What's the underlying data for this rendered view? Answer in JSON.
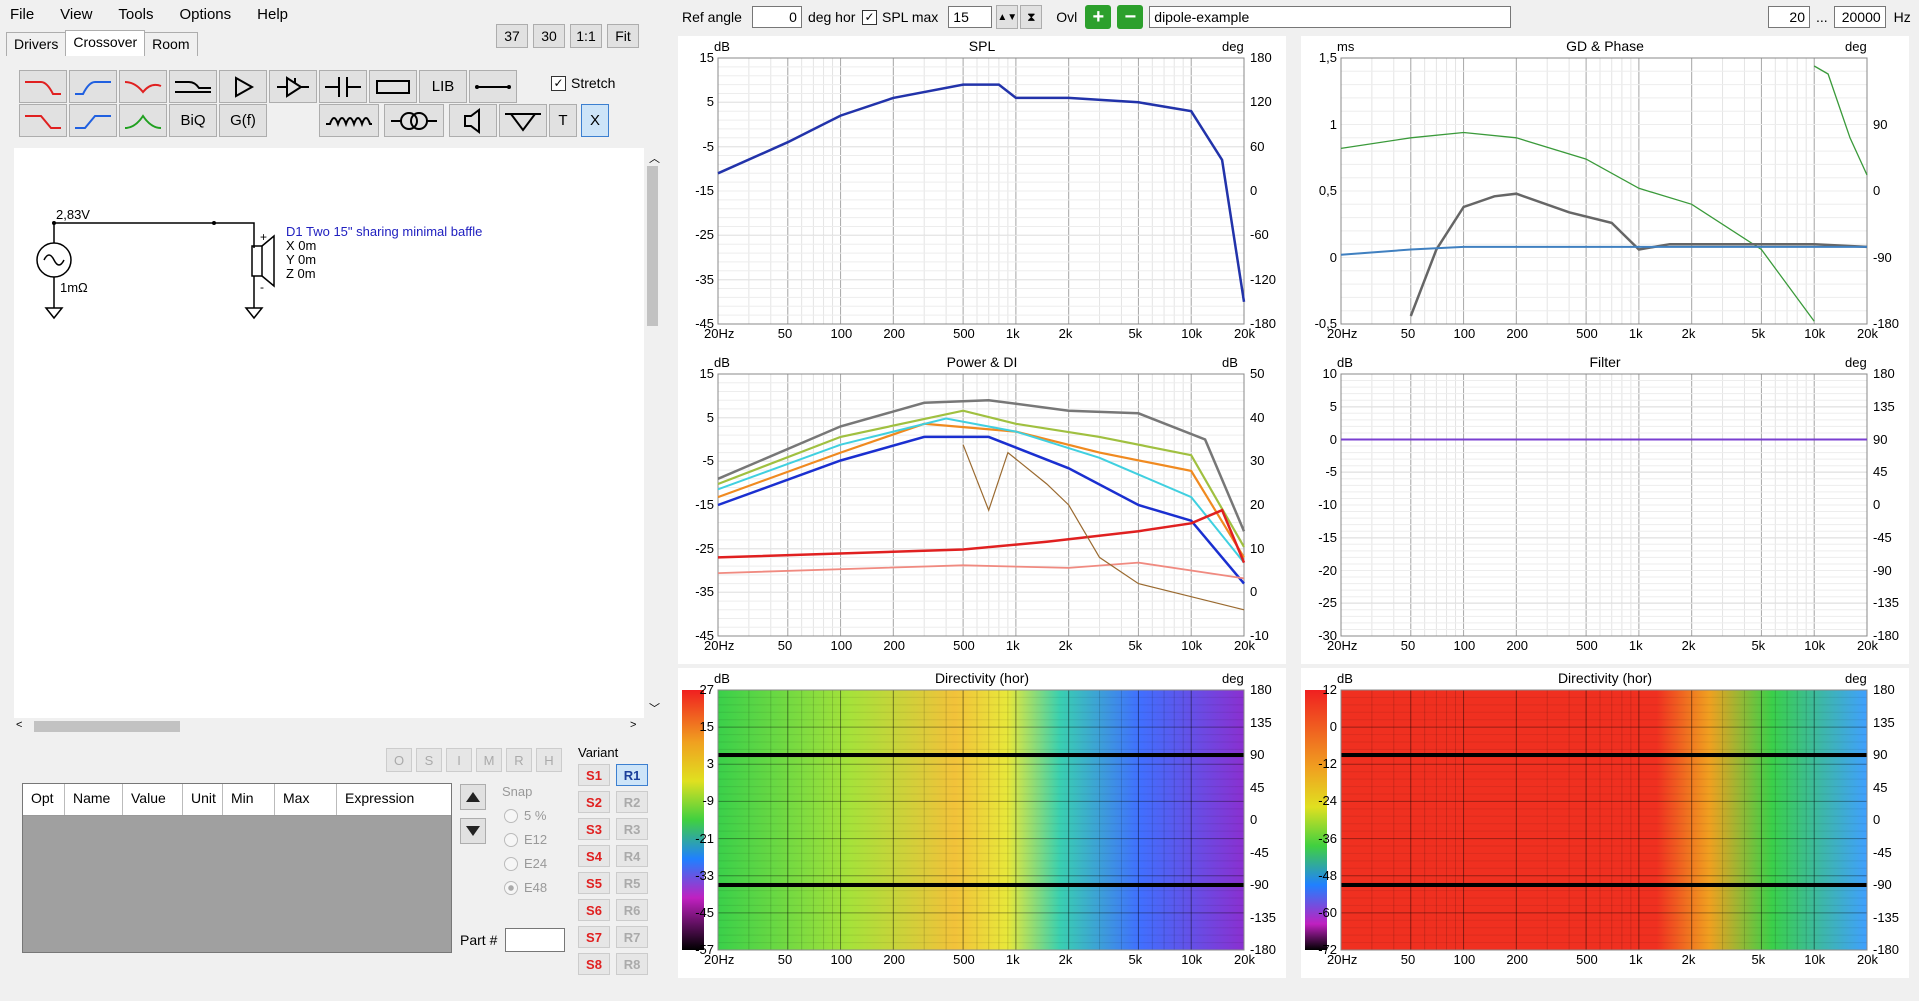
{
  "menu": [
    "File",
    "View",
    "Tools",
    "Options",
    "Help"
  ],
  "tabs": [
    "Drivers",
    "Crossover",
    "Room"
  ],
  "top_buttons": [
    "37",
    "30",
    "1:1",
    "Fit"
  ],
  "component_text": {
    "lib": "LIB",
    "biq": "BiQ",
    "gf": "G(f)",
    "t": "T",
    "x": "X"
  },
  "stretch_label": "Stretch",
  "schematic": {
    "voltage": "2,83V",
    "resistance": "1mΩ",
    "driver_name": "D1 Two 15\" sharing minimal baffle",
    "x": "X 0m",
    "y": "Y 0m",
    "z": "Z 0m"
  },
  "side_buttons": [
    "O",
    "S",
    "I",
    "M",
    "R",
    "H"
  ],
  "table_headers": [
    "Opt",
    "Name",
    "Value",
    "Unit",
    "Min",
    "Max",
    "Expression"
  ],
  "snap": {
    "label": "Snap",
    "options": [
      "5 %",
      "E12",
      "E24",
      "E48"
    ],
    "selected": "E48"
  },
  "part_label": "Part #",
  "variant": {
    "label": "Variant",
    "s": [
      "S1",
      "S2",
      "S3",
      "S4",
      "S5",
      "S6",
      "S7",
      "S8"
    ],
    "r": [
      "R1",
      "R2",
      "R3",
      "R4",
      "R5",
      "R6",
      "R7",
      "R8"
    ],
    "active": "R1"
  },
  "topbar": {
    "ref_angle_label": "Ref angle",
    "ref_angle": "0",
    "deg_hor": "deg hor",
    "spl_max_label": "SPL max",
    "spl_max": "15",
    "ovl": "Ovl",
    "project": "dipole-example",
    "f_min": "20",
    "dots": "...",
    "f_max": "20000",
    "hz": "Hz"
  },
  "freq_ticks": [
    "20Hz",
    "50",
    "100",
    "200",
    "500",
    "1k",
    "2k",
    "5k",
    "10k",
    "20k"
  ],
  "panels": {
    "spl": {
      "title": "SPL",
      "left_unit": "dB",
      "right_unit": "deg",
      "left": [
        "15",
        "5",
        "-5",
        "-15",
        "-25",
        "-35",
        "-45"
      ],
      "right": [
        "180",
        "120",
        "60",
        "0",
        "-60",
        "-120",
        "-180"
      ]
    },
    "gd": {
      "title": "GD & Phase",
      "left_unit": "ms",
      "right_unit": "deg",
      "left": [
        "1,5",
        "1",
        "0,5",
        "0",
        "-0,5"
      ],
      "right": [
        "",
        "90",
        "0",
        "-90",
        "-180"
      ]
    },
    "power": {
      "title": "Power & DI",
      "left_unit": "dB",
      "right_unit": "dB",
      "left": [
        "15",
        "5",
        "-5",
        "-15",
        "-25",
        "-35",
        "-45"
      ],
      "right": [
        "50",
        "40",
        "30",
        "20",
        "10",
        "0",
        "-10"
      ]
    },
    "filter": {
      "title": "Filter",
      "left_unit": "dB",
      "right_unit": "deg",
      "left": [
        "10",
        "5",
        "0",
        "-5",
        "-10",
        "-15",
        "-20",
        "-25",
        "-30"
      ],
      "right": [
        "180",
        "135",
        "90",
        "45",
        "0",
        "-45",
        "-90",
        "-135",
        "-180"
      ]
    },
    "dir1": {
      "title": "Directivity (hor)",
      "left_unit": "dB",
      "right_unit": "deg",
      "left": [
        "27",
        "15",
        "3",
        "-9",
        "-21",
        "-33",
        "-45",
        "-57"
      ],
      "right": [
        "180",
        "135",
        "90",
        "45",
        "0",
        "-45",
        "-90",
        "-135",
        "-180"
      ]
    },
    "dir2": {
      "title": "Directivity (hor)",
      "left_unit": "dB",
      "right_unit": "deg",
      "left": [
        "12",
        "0",
        "-12",
        "-24",
        "-36",
        "-48",
        "-60",
        "-72"
      ],
      "right": [
        "180",
        "135",
        "90",
        "45",
        "0",
        "-45",
        "-90",
        "-135",
        "-180"
      ]
    }
  },
  "colors": {
    "spl_curve": "#2233aa",
    "phase": "#3a9a3a",
    "gd": "#666666",
    "filter": "#7a3fd0",
    "accent": "#0078d7"
  },
  "chart_data": [
    {
      "type": "line",
      "title": "SPL",
      "x": [
        20,
        50,
        100,
        200,
        500,
        800,
        1000,
        2000,
        5000,
        10000,
        15000,
        20000
      ],
      "series": [
        {
          "name": "",
          "values": [
            -11,
            -4,
            2,
            6,
            9,
            9,
            6,
            6,
            5,
            3,
            -8,
            -40
          ]
        }
      ],
      "ylim": [
        -45,
        15
      ],
      "xlabel": "",
      "ylabel": "dB"
    },
    {
      "type": "line",
      "title": "Filter",
      "x": [
        20,
        20000
      ],
      "series": [
        {
          "name": "",
          "values": [
            0,
            0
          ]
        }
      ],
      "ylim": [
        -30,
        10
      ],
      "ylabel": "dB"
    }
  ]
}
